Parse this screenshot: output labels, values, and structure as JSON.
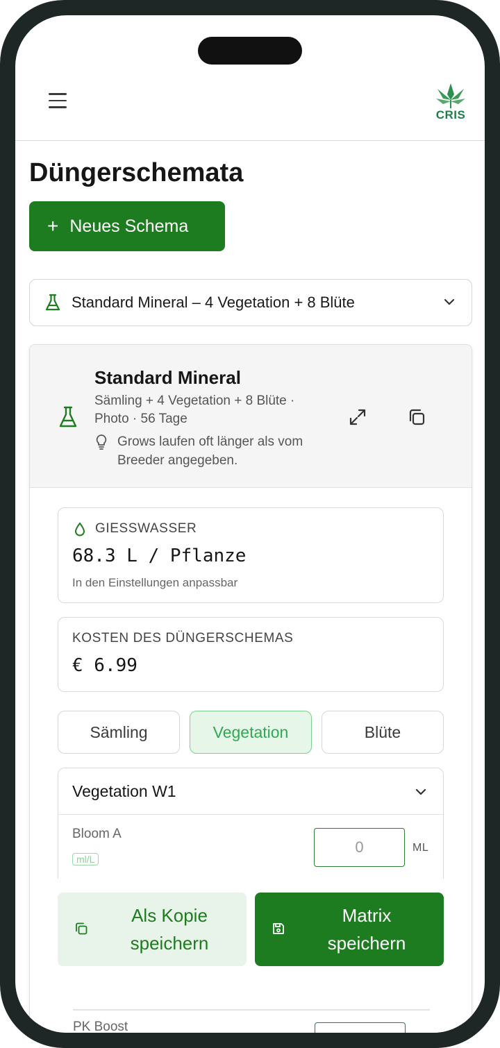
{
  "header": {
    "logo_text": "CRIS"
  },
  "page": {
    "title": "Düngerschemata",
    "new_button_label": "Neues Schema",
    "selected_schema": "Standard Mineral – 4 Vegetation + 8 Blüte"
  },
  "schema": {
    "name": "Standard Mineral",
    "meta": "Sämling + 4 Vegetation + 8 Blüte · Photo · 56 Tage",
    "hint": "Grows laufen oft länger als vom Breeder angegeben."
  },
  "water": {
    "label": "GIESSWASSER",
    "value": "68.3 L / Pflanze",
    "note": "In den Einstellungen anpassbar"
  },
  "cost": {
    "label": "KOSTEN DES DÜNGERSCHEMAS",
    "value": "€ 6.99"
  },
  "phases": [
    {
      "label": "Sämling",
      "active": false
    },
    {
      "label": "Vegetation",
      "active": true
    },
    {
      "label": "Blüte",
      "active": false
    }
  ],
  "week": {
    "title": "Vegetation W1",
    "nutrients": [
      {
        "name": "Bloom A",
        "unit": "ml/L",
        "value": "0",
        "unit_short": "ML"
      },
      {
        "name": "PK Boost"
      }
    ]
  },
  "actions": {
    "copy_save": "Als Kopie speichern",
    "matrix_save": "Matrix speichern"
  },
  "colors": {
    "primary": "#1e7c20",
    "primary_light": "#e8f3e9",
    "active_tab_bg": "#e6f7ea",
    "active_tab_text": "#32a852"
  }
}
